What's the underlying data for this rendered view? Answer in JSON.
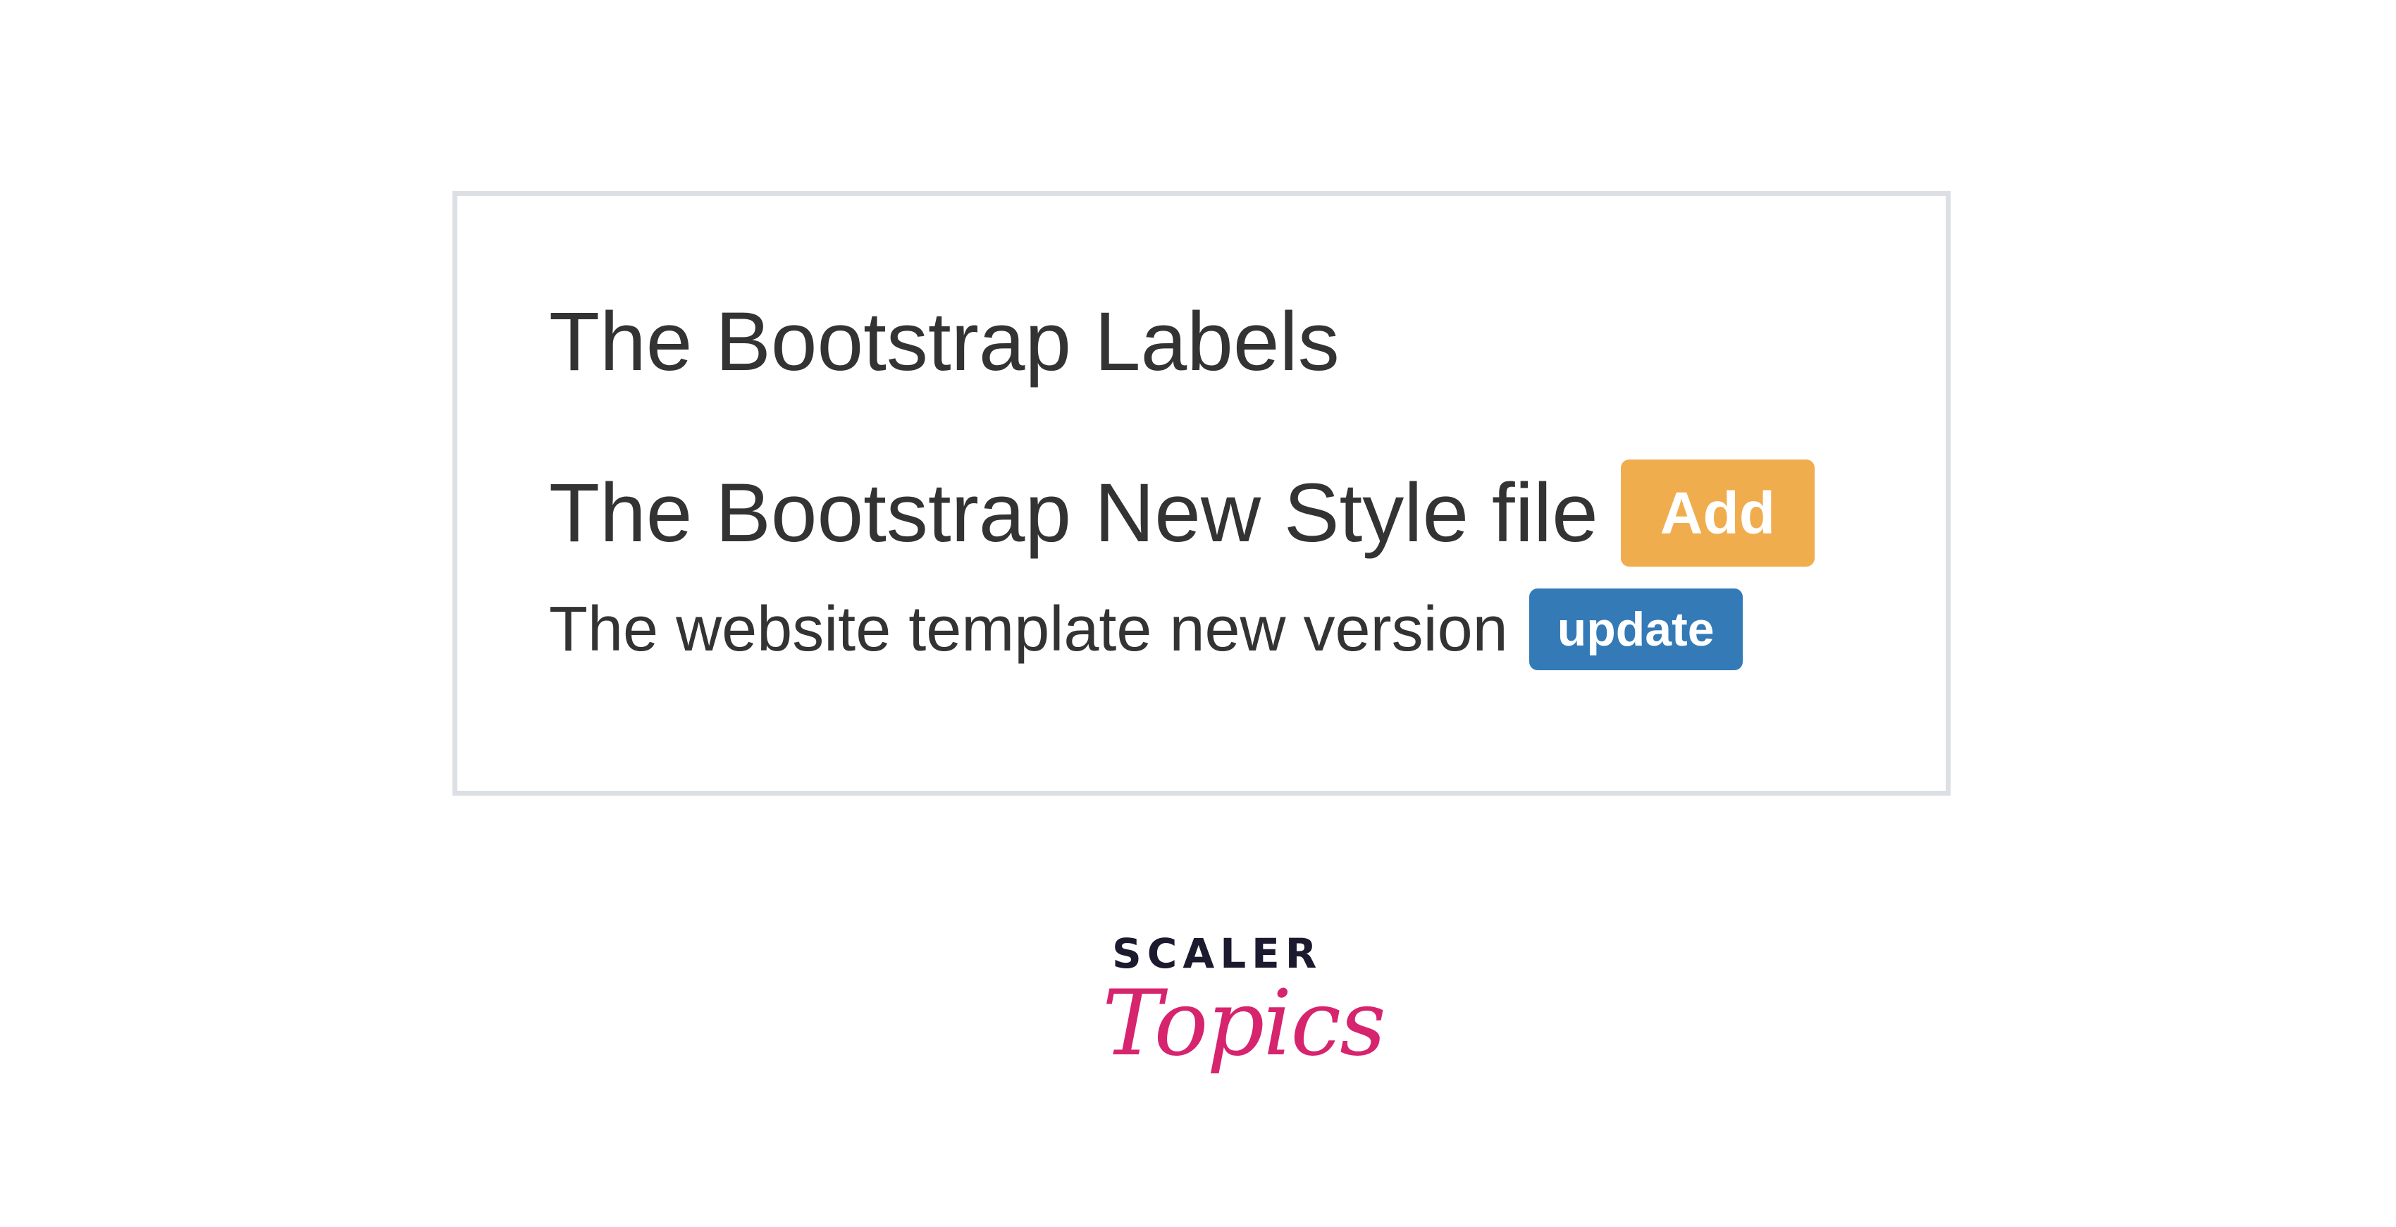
{
  "demo": {
    "heading1": "The Bootstrap Labels",
    "heading2": "The Bootstrap New Style file",
    "heading2_badge": "Add",
    "heading3": "The website template new version",
    "heading3_badge": "update"
  },
  "brand": {
    "line1": "SCALER",
    "line2": "Topics"
  },
  "colors": {
    "frame_border": "#dce0e5",
    "text": "#333333",
    "badge_warning": "#f0ad4e",
    "badge_primary": "#337ab7",
    "brand_dark": "#1b1a2e",
    "brand_pink": "#d6246e"
  }
}
